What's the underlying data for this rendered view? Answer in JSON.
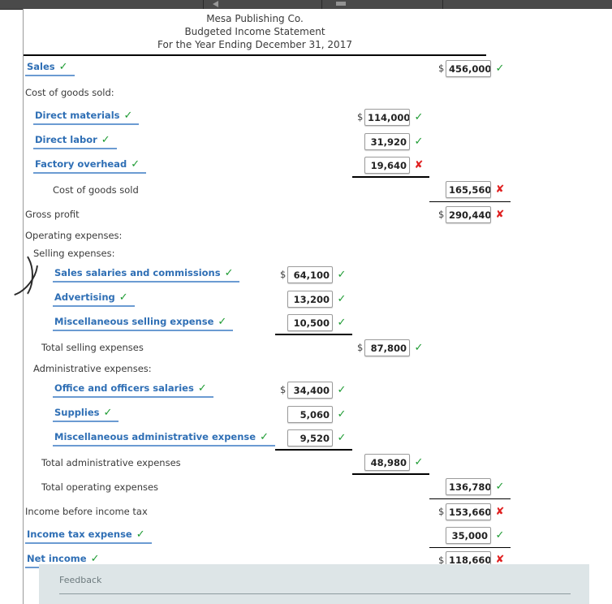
{
  "toolbar": {
    "speaker_icon": "speaker-icon",
    "window_icon": "window-icon"
  },
  "header": {
    "company": "Mesa Publishing Co.",
    "statement_title": "Budgeted Income Statement",
    "period": "For the Year Ending December 31, 2017"
  },
  "symbols": {
    "dollar": "$",
    "check": "✓",
    "cross": "✘"
  },
  "rows": {
    "sales": {
      "label": "Sales",
      "label_mark": "✓",
      "value": "456,000",
      "mark": "✓"
    },
    "cogs_heading": {
      "label": "Cost of goods sold:"
    },
    "direct_materials": {
      "label": "Direct materials",
      "label_mark": "✓",
      "value": "114,000",
      "mark": "✓"
    },
    "direct_labor": {
      "label": "Direct labor",
      "label_mark": "✓",
      "value": "31,920",
      "mark": "✓"
    },
    "factory_overhead": {
      "label": "Factory overhead",
      "label_mark": "✓",
      "value": "19,640",
      "mark": "✘"
    },
    "cogs_total": {
      "label": "Cost of goods sold",
      "value": "165,560",
      "mark": "✘"
    },
    "gross_profit": {
      "label": "Gross profit",
      "value": "290,440",
      "mark": "✘"
    },
    "operating_heading": {
      "label": "Operating expenses:"
    },
    "selling_heading": {
      "label": "Selling expenses:"
    },
    "sales_salaries": {
      "label": "Sales salaries and commissions",
      "label_mark": "✓",
      "value": "64,100",
      "mark": "✓"
    },
    "advertising": {
      "label": "Advertising",
      "label_mark": "✓",
      "value": "13,200",
      "mark": "✓"
    },
    "misc_selling": {
      "label": "Miscellaneous selling expense",
      "label_mark": "✓",
      "value": "10,500",
      "mark": "✓"
    },
    "total_selling": {
      "label": "Total selling expenses",
      "value": "87,800",
      "mark": "✓"
    },
    "admin_heading": {
      "label": "Administrative expenses:"
    },
    "office_salaries": {
      "label": "Office and officers salaries",
      "label_mark": "✓",
      "value": "34,400",
      "mark": "✓"
    },
    "supplies": {
      "label": "Supplies",
      "label_mark": "✓",
      "value": "5,060",
      "mark": "✓"
    },
    "misc_admin": {
      "label": "Miscellaneous administrative expense",
      "label_mark": "✓",
      "value": "9,520",
      "mark": "✓"
    },
    "total_admin": {
      "label": "Total administrative expenses",
      "value": "48,980",
      "mark": "✓"
    },
    "total_operating": {
      "label": "Total operating expenses",
      "value": "136,780",
      "mark": "✓"
    },
    "income_before_tax": {
      "label": "Income before income tax",
      "value": "153,660",
      "mark": "✘"
    },
    "income_tax_expense": {
      "label": "Income tax expense",
      "label_mark": "✓",
      "value": "35,000",
      "mark": "✓"
    },
    "net_income": {
      "label": "Net income",
      "label_mark": "✓",
      "value": "118,660",
      "mark": "✘"
    }
  },
  "feedback": {
    "label": "Feedback"
  },
  "colors": {
    "accent_blue": "#2f6fb5",
    "underline_blue": "#6b9bd2",
    "correct_green": "#1d9b32",
    "incorrect_red": "#e02020",
    "feedback_bg": "#dde5e7"
  }
}
